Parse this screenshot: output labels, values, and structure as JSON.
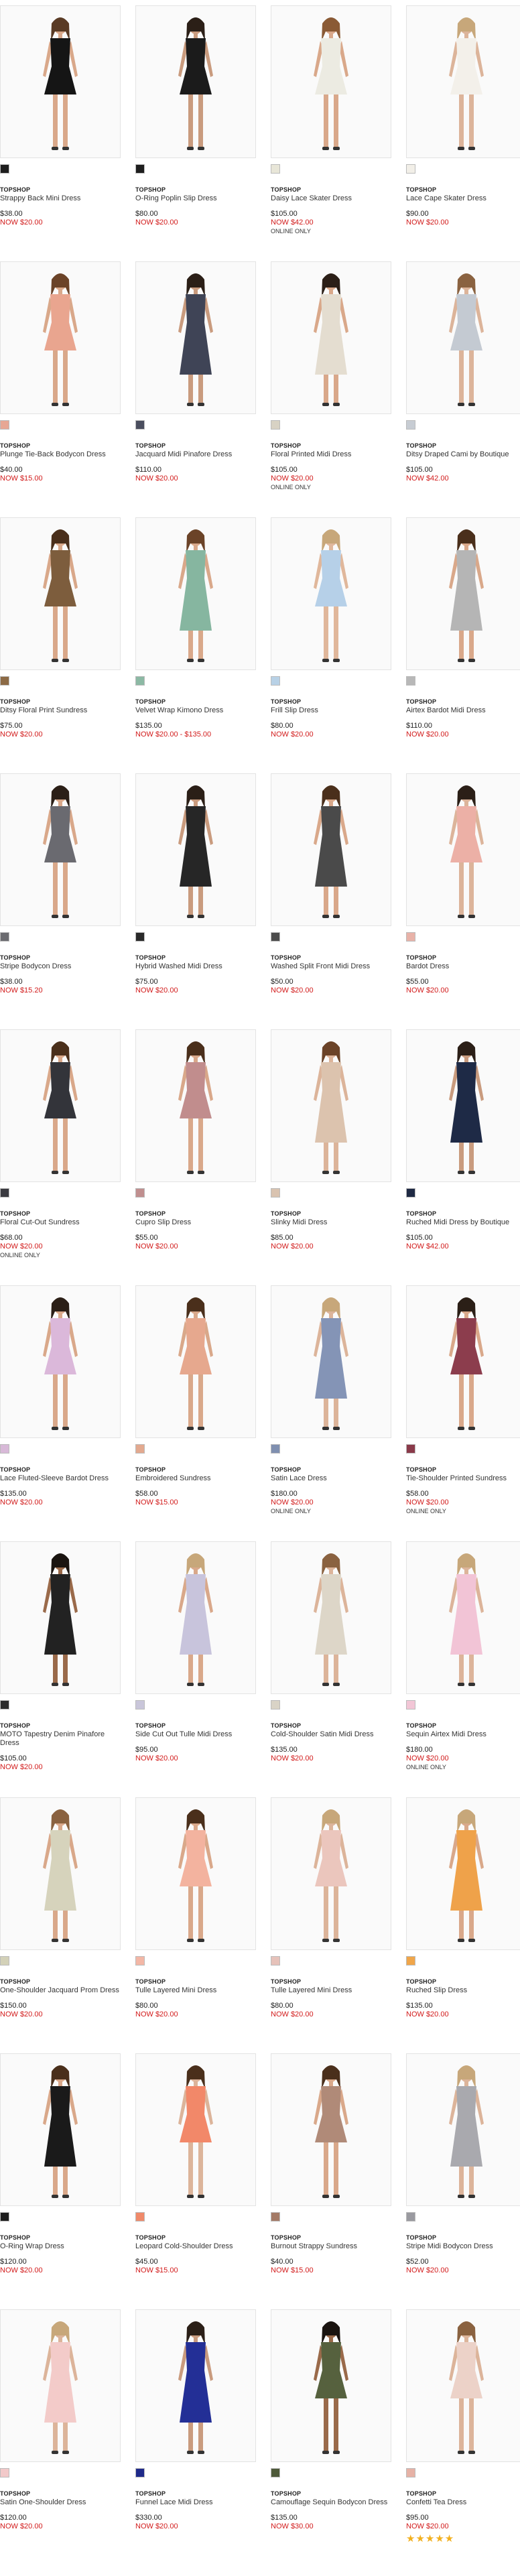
{
  "products": [
    {
      "brand": "TOPSHOP",
      "name": "Strappy Back Mini Dress",
      "price": "$38.00",
      "now": "NOW $20.00",
      "online": "",
      "stars": "",
      "swatch": "#1e1e1e",
      "dress": "#151515",
      "skin": "#d9a88a",
      "hair": "#5a3b25"
    },
    {
      "brand": "TOPSHOP",
      "name": "O-Ring Poplin Slip Dress",
      "price": "$80.00",
      "now": "NOW $20.00",
      "online": "",
      "stars": "",
      "swatch": "#1e1e1e",
      "dress": "#1b1b1b",
      "skin": "#c99b7e",
      "hair": "#2b1f17"
    },
    {
      "brand": "TOPSHOP",
      "name": "Daisy Lace Skater Dress",
      "price": "$105.00",
      "now": "NOW $42.00",
      "online": "ONLINE ONLY",
      "stars": "",
      "swatch": "#e8e6d8",
      "dress": "#ecebe2",
      "skin": "#d9a88a",
      "hair": "#8a5a35"
    },
    {
      "brand": "TOPSHOP",
      "name": "Lace Cape Skater Dress",
      "price": "$90.00",
      "now": "NOW $20.00",
      "online": "",
      "stars": "",
      "swatch": "#f2efe8",
      "dress": "#f3f0ea",
      "skin": "#dcb49a",
      "hair": "#c7a77a"
    },
    {
      "brand": "TOPSHOP",
      "name": "Plunge Tie-Back Bodycon Dress",
      "price": "$40.00",
      "now": "NOW $15.00",
      "online": "",
      "stars": "",
      "swatch": "#e7a794",
      "dress": "#e9a58f",
      "skin": "#d9a88a",
      "hair": "#6b4328"
    },
    {
      "brand": "TOPSHOP",
      "name": "Jacquard Midi Pinafore Dress",
      "price": "$110.00",
      "now": "NOW $20.00",
      "online": "",
      "stars": "",
      "swatch": "#4a4e5e",
      "dress": "#3f4456",
      "skin": "#c99b7e",
      "hair": "#2b1f17"
    },
    {
      "brand": "TOPSHOP",
      "name": "Floral Printed Midi Dress",
      "price": "$105.00",
      "now": "NOW $20.00",
      "online": "ONLINE ONLY",
      "stars": "",
      "swatch": "#d8d2c4",
      "dress": "#e4ddd0",
      "skin": "#d9a88a",
      "hair": "#2b1f17"
    },
    {
      "brand": "TOPSHOP",
      "name": "Ditsy Draped Cami by Boutique",
      "price": "$105.00",
      "now": "NOW $42.00",
      "online": "",
      "stars": "",
      "swatch": "#c7ccd3",
      "dress": "#c4cad2",
      "skin": "#dcb49a",
      "hair": "#8a6240"
    },
    {
      "brand": "TOPSHOP",
      "name": "Ditsy Floral Print Sundress",
      "price": "$75.00",
      "now": "NOW $20.00",
      "online": "",
      "stars": "",
      "swatch": "#8c6a45",
      "dress": "#7d5d3d",
      "skin": "#d9a88a",
      "hair": "#4a2f1b"
    },
    {
      "brand": "TOPSHOP",
      "name": "Velvet Wrap Kimono Dress",
      "price": "$135.00",
      "now": "NOW $20.00 - $135.00",
      "online": "",
      "stars": "",
      "swatch": "#8cb9a4",
      "dress": "#86b6a0",
      "skin": "#d9a88a",
      "hair": "#6b4328"
    },
    {
      "brand": "TOPSHOP",
      "name": "Frill Slip Dress",
      "price": "$80.00",
      "now": "NOW $20.00",
      "online": "",
      "stars": "",
      "swatch": "#b8d1e6",
      "dress": "#b6d0e8",
      "skin": "#e0b79b",
      "hair": "#c7a77a"
    },
    {
      "brand": "TOPSHOP",
      "name": "Airtex Bardot Midi Dress",
      "price": "$110.00",
      "now": "NOW $20.00",
      "online": "",
      "stars": "",
      "swatch": "#b8b8b8",
      "dress": "#b5b5b5",
      "skin": "#d9a88a",
      "hair": "#4a2f1b"
    },
    {
      "brand": "TOPSHOP",
      "name": "Stripe Bodycon Dress",
      "price": "$38.00",
      "now": "NOW $15.20",
      "online": "",
      "stars": "",
      "swatch": "#6b6b70",
      "dress": "#6a6a70",
      "skin": "#d9a88a",
      "hair": "#2b1f17"
    },
    {
      "brand": "TOPSHOP",
      "name": "Hybrid Washed Midi Dress",
      "price": "$75.00",
      "now": "NOW $20.00",
      "online": "",
      "stars": "",
      "swatch": "#2a2a2a",
      "dress": "#262626",
      "skin": "#c99b7e",
      "hair": "#2b1f17"
    },
    {
      "brand": "TOPSHOP",
      "name": "Washed Split Front Midi Dress",
      "price": "$50.00",
      "now": "NOW $20.00",
      "online": "",
      "stars": "",
      "swatch": "#4c4c4c",
      "dress": "#4a4a4a",
      "skin": "#d9a88a",
      "hair": "#4a2f1b"
    },
    {
      "brand": "TOPSHOP",
      "name": "Bardot Dress",
      "price": "$55.00",
      "now": "NOW $20.00",
      "online": "",
      "stars": "",
      "swatch": "#e8b2a8",
      "dress": "#ecb0a6",
      "skin": "#dcb49a",
      "hair": "#2b1f17"
    },
    {
      "brand": "TOPSHOP",
      "name": "Floral Cut-Out Sundress",
      "price": "$68.00",
      "now": "NOW $20.00",
      "online": "ONLINE ONLY",
      "stars": "",
      "swatch": "#3a3a40",
      "dress": "#33343a",
      "skin": "#d9a88a",
      "hair": "#4a2f1b"
    },
    {
      "brand": "TOPSHOP",
      "name": "Cupro Slip Dress",
      "price": "$55.00",
      "now": "NOW $20.00",
      "online": "",
      "stars": "",
      "swatch": "#c08f8f",
      "dress": "#c18d8d",
      "skin": "#d9a88a",
      "hair": "#4a2f1b"
    },
    {
      "brand": "TOPSHOP",
      "name": "Slinky Midi Dress",
      "price": "$85.00",
      "now": "NOW $20.00",
      "online": "",
      "stars": "",
      "swatch": "#d9c3b0",
      "dress": "#dcc3ae",
      "skin": "#dcb49a",
      "hair": "#6b4328"
    },
    {
      "brand": "TOPSHOP",
      "name": "Ruched Midi Dress by Boutique",
      "price": "$105.00",
      "now": "NOW $42.00",
      "online": "",
      "stars": "",
      "swatch": "#1f2a44",
      "dress": "#1e2a46",
      "skin": "#c99b7e",
      "hair": "#2b1f17"
    },
    {
      "brand": "TOPSHOP",
      "name": "Lace Fluted-Sleeve Bardot Dress",
      "price": "$135.00",
      "now": "NOW $20.00",
      "online": "",
      "stars": "",
      "swatch": "#d8b9d8",
      "dress": "#dbb8da",
      "skin": "#d9a88a",
      "hair": "#2b1f17"
    },
    {
      "brand": "TOPSHOP",
      "name": "Embroidered Sundress",
      "price": "$58.00",
      "now": "NOW $15.00",
      "online": "",
      "stars": "",
      "swatch": "#e3a98f",
      "dress": "#e6a88e",
      "skin": "#d9a88a",
      "hair": "#4a2f1b"
    },
    {
      "brand": "TOPSHOP",
      "name": "Satin Lace Dress",
      "price": "$180.00",
      "now": "NOW $20.00",
      "online": "ONLINE ONLY",
      "stars": "",
      "swatch": "#7f8fb0",
      "dress": "#8494b6",
      "skin": "#dcb49a",
      "hair": "#c7a77a"
    },
    {
      "brand": "TOPSHOP",
      "name": "Tie-Shoulder Printed Sundress",
      "price": "$58.00",
      "now": "NOW $20.00",
      "online": "ONLINE ONLY",
      "stars": "",
      "swatch": "#8a3a4a",
      "dress": "#8c3d4d",
      "skin": "#d9a88a",
      "hair": "#2b1f17"
    },
    {
      "brand": "TOPSHOP",
      "name": "MOTO Tapestry Denim Pinafore Dress",
      "price": "$105.00",
      "now": "NOW $20.00",
      "online": "",
      "stars": "",
      "swatch": "#2a2a2a",
      "dress": "#222222",
      "skin": "#9a6a4a",
      "hair": "#1a1410"
    },
    {
      "brand": "TOPSHOP",
      "name": "Side Cut Out Tulle Midi Dress",
      "price": "$95.00",
      "now": "NOW $20.00",
      "online": "",
      "stars": "",
      "swatch": "#c9c6da",
      "dress": "#c8c4dc",
      "skin": "#d9a88a",
      "hair": "#c7a77a"
    },
    {
      "brand": "TOPSHOP",
      "name": "Cold-Shoulder Satin Midi Dress",
      "price": "$135.00",
      "now": "NOW $20.00",
      "online": "",
      "stars": "",
      "swatch": "#d9d3c6",
      "dress": "#ddd6c8",
      "skin": "#dcb49a",
      "hair": "#8a6240"
    },
    {
      "brand": "TOPSHOP",
      "name": "Sequin Airtex Midi Dress",
      "price": "$180.00",
      "now": "NOW $20.00",
      "online": "ONLINE ONLY",
      "stars": "",
      "swatch": "#f2c6d6",
      "dress": "#f2c4d6",
      "skin": "#dcb49a",
      "hair": "#c7a77a"
    },
    {
      "brand": "TOPSHOP",
      "name": "One-Shoulder Jacquard Prom Dress",
      "price": "$150.00",
      "now": "NOW $20.00",
      "online": "",
      "stars": "",
      "swatch": "#d3d1b8",
      "dress": "#d6d3bc",
      "skin": "#d9a88a",
      "hair": "#8a6240"
    },
    {
      "brand": "TOPSHOP",
      "name": "Tulle Layered Mini Dress",
      "price": "$80.00",
      "now": "NOW $20.00",
      "online": "",
      "stars": "",
      "swatch": "#f3b7a6",
      "dress": "#f3b39f",
      "skin": "#d9a88a",
      "hair": "#4a2f1b"
    },
    {
      "brand": "TOPSHOP",
      "name": "Tulle Layered Mini Dress",
      "price": "$80.00",
      "now": "NOW $20.00",
      "online": "",
      "stars": "",
      "swatch": "#e6c2ba",
      "dress": "#ebc6bd",
      "skin": "#dcb49a",
      "hair": "#c7a77a"
    },
    {
      "brand": "TOPSHOP",
      "name": "Ruched Slip Dress",
      "price": "$135.00",
      "now": "NOW $20.00",
      "online": "",
      "stars": "",
      "swatch": "#f0a64a",
      "dress": "#efa24a",
      "skin": "#d9a88a",
      "hair": "#c7a77a"
    },
    {
      "brand": "TOPSHOP",
      "name": "O-Ring Wrap Dress",
      "price": "$120.00",
      "now": "NOW $20.00",
      "online": "",
      "stars": "",
      "swatch": "#1e1e1e",
      "dress": "#1a1a1a",
      "skin": "#d9a88a",
      "hair": "#4a2f1b"
    },
    {
      "brand": "TOPSHOP",
      "name": "Leopard Cold-Shoulder Dress",
      "price": "$45.00",
      "now": "NOW $15.00",
      "online": "",
      "stars": "",
      "swatch": "#f08a6a",
      "dress": "#f28869",
      "skin": "#dcb49a",
      "hair": "#4a2f1b"
    },
    {
      "brand": "TOPSHOP",
      "name": "Burnout Strappy Sundress",
      "price": "$40.00",
      "now": "NOW $15.00",
      "online": "",
      "stars": "",
      "swatch": "#a47a66",
      "dress": "#b08a78",
      "skin": "#d9a88a",
      "hair": "#4a2f1b"
    },
    {
      "brand": "TOPSHOP",
      "name": "Stripe Midi Bodycon Dress",
      "price": "$52.00",
      "now": "NOW $20.00",
      "online": "",
      "stars": "",
      "swatch": "#9a9aa0",
      "dress": "#a9a9ae",
      "skin": "#dcb49a",
      "hair": "#c7a77a"
    },
    {
      "brand": "TOPSHOP",
      "name": "Satin One-Shoulder Dress",
      "price": "$120.00",
      "now": "NOW $20.00",
      "online": "",
      "stars": "",
      "swatch": "#f2c9c9",
      "dress": "#f3cbc9",
      "skin": "#dcb49a",
      "hair": "#c7a77a"
    },
    {
      "brand": "TOPSHOP",
      "name": "Funnel Lace Midi Dress",
      "price": "$330.00",
      "now": "NOW $20.00",
      "online": "",
      "stars": "",
      "swatch": "#1f2a8a",
      "dress": "#232f96",
      "skin": "#c99b7e",
      "hair": "#2b1f17"
    },
    {
      "brand": "TOPSHOP",
      "name": "Camouflage Sequin Bodycon Dress",
      "price": "$135.00",
      "now": "NOW $30.00",
      "online": "",
      "stars": "",
      "swatch": "#4e5a3a",
      "dress": "#56613e",
      "skin": "#9a6a4a",
      "hair": "#1a1410"
    },
    {
      "brand": "TOPSHOP",
      "name": "Confetti Tea Dress",
      "price": "$95.00",
      "now": "NOW $20.00",
      "online": "",
      "stars": "★★★★★",
      "swatch": "#e6b2a6",
      "dress": "#ecd2c8",
      "skin": "#dcb49a",
      "hair": "#8a6240"
    }
  ]
}
